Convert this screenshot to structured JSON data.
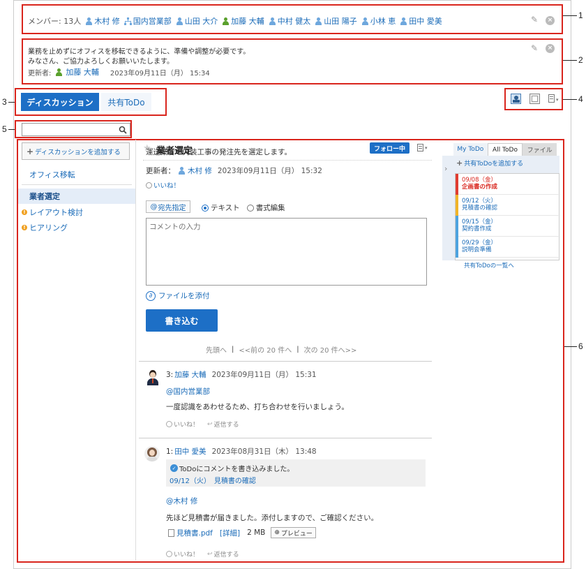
{
  "members": {
    "label": "メンバー: 13人",
    "items": [
      {
        "name": "木村 修",
        "type": "user"
      },
      {
        "name": "国内営業部",
        "type": "org"
      },
      {
        "name": "山田 大介",
        "type": "user"
      },
      {
        "name": "加藤 大輔",
        "type": "user-green"
      },
      {
        "name": "中村 健太",
        "type": "user"
      },
      {
        "name": "山田 陽子",
        "type": "user"
      },
      {
        "name": "小林 恵",
        "type": "user"
      },
      {
        "name": "田中 愛美",
        "type": "user"
      }
    ]
  },
  "description": {
    "line1": "業務を止めずにオフィスを移転できるように、準備や調整が必要です。",
    "line2": "みなさん、ご協力よろしくお願いいたします。",
    "updater_label": "更新者:",
    "updater": "加藤 大輔",
    "updated_at": "2023年09月11日（月） 15:34"
  },
  "tabs": {
    "discussion": "ディスカッション",
    "shared_todo": "共有ToDo"
  },
  "sidebar": {
    "search_placeholder": "",
    "add_button": "ディスカッションを追加する",
    "items": [
      {
        "label": "オフィス移転",
        "selected": false,
        "alert": false
      },
      {
        "label": "業者選定",
        "selected": true,
        "alert": false
      },
      {
        "label": "レイアウト検討",
        "selected": false,
        "alert": true
      },
      {
        "label": "ヒアリング",
        "selected": false,
        "alert": true
      }
    ]
  },
  "topic": {
    "title": "業者選定",
    "follow_button": "フォロー中",
    "body": "運送業者や内装工事の発注先を選定します。",
    "updater_label": "更新者：",
    "updater": "木村 修",
    "updated_at": "2023年09月11日（月） 15:32",
    "like": "いいね！"
  },
  "composer": {
    "mention_button": "宛先指定",
    "option_text": "テキスト",
    "option_format": "書式編集",
    "placeholder": "コメントの入力",
    "attach": "ファイルを添付",
    "submit": "書き込む"
  },
  "pager": {
    "first": "先頭へ",
    "prev": "<<前の 20 件へ",
    "next": "次の 20 件へ>>",
    "divider": "|"
  },
  "comments": [
    {
      "num": "3:",
      "author": "加藤 大輔",
      "date": "2023年09月11日（月） 15:31",
      "mention": "@国内営業部",
      "text": "一度認識をあわせるため、打ち合わせを行いましょう。",
      "like": "いいね！",
      "reply": "返信する"
    },
    {
      "num": "1:",
      "author": "田中 愛美",
      "date": "2023年08月31日（木） 13:48",
      "todo_note": "ToDoにコメントを書き込みました。",
      "todo_link": "09/12（火）　見積書の確認",
      "mention": "@木村 修",
      "text": "先ほど見積書が届きました。添付しますので、ご確認ください。",
      "file_name": "見積書.pdf",
      "file_detail": "[詳細]",
      "file_size": "2 MB",
      "preview": "プレビュー",
      "like": "いいね！",
      "reply": "返信する"
    }
  ],
  "todo_panel": {
    "tabs": [
      "My ToDo",
      "All ToDo",
      "ファイル"
    ],
    "active_tab": "All ToDo",
    "add": "共有ToDoを追加する",
    "items": [
      {
        "date": "09/08（金）",
        "title": "企画書の作成",
        "color": "#e03c31",
        "overdue": true
      },
      {
        "date": "09/12（火）",
        "title": "見積書の確認",
        "color": "#f0b429",
        "overdue": false
      },
      {
        "date": "09/15（金）",
        "title": "契約書作成",
        "color": "#4da3df",
        "overdue": false
      },
      {
        "date": "09/29（金）",
        "title": "説明会準備",
        "color": "#4da3df",
        "overdue": false
      }
    ],
    "list_link": "共有ToDoの一覧へ"
  },
  "callouts": [
    "1",
    "2",
    "3",
    "4",
    "5",
    "6"
  ]
}
